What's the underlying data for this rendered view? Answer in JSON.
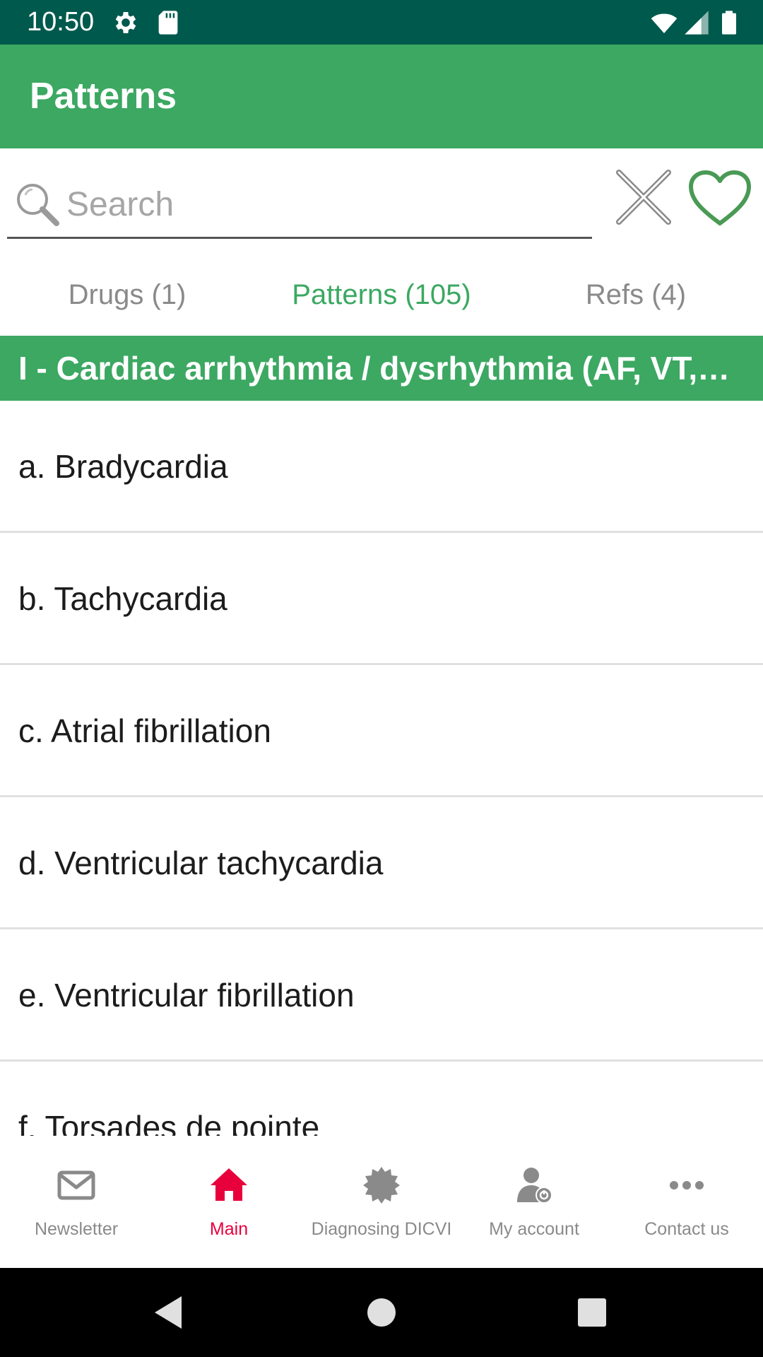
{
  "status_bar": {
    "time": "10:50",
    "left_icons": [
      "gear-icon",
      "sd-card-icon"
    ],
    "right_icons": [
      "wifi-icon",
      "cell-signal-icon",
      "battery-icon"
    ]
  },
  "app_bar": {
    "title": "Patterns",
    "color": "#3ca862"
  },
  "search": {
    "placeholder": "Search",
    "value": "",
    "clear_icon": "close-icon",
    "favorite_icon": "heart-icon"
  },
  "tabs": [
    {
      "label": "Drugs (1)",
      "active": false
    },
    {
      "label": "Patterns (105)",
      "active": true
    },
    {
      "label": "Refs (4)",
      "active": false
    }
  ],
  "section": {
    "title": "I - Cardiac arrhythmia / dysrhythmia (AF, VT, VF, TdP)"
  },
  "list": {
    "items": [
      "a. Bradycardia",
      "b. Tachycardia",
      "c. Atrial fibrillation",
      "d. Ventricular tachycardia",
      "e. Ventricular fibrillation",
      "f. Torsades de pointe"
    ]
  },
  "bottom_nav": {
    "items": [
      {
        "label": "Newsletter",
        "icon": "envelope-icon",
        "active": false
      },
      {
        "label": "Main",
        "icon": "home-icon",
        "active": true
      },
      {
        "label": "Diagnosing DICVI",
        "icon": "badge-icon",
        "active": false
      },
      {
        "label": "My account",
        "icon": "user-settings-icon",
        "active": false
      },
      {
        "label": "Contact us",
        "icon": "more-dots-icon",
        "active": false
      }
    ],
    "active_color": "#e8003d",
    "inactive_color": "#8a8a8a"
  },
  "system_nav": {
    "buttons": [
      "back-icon",
      "home-circle-icon",
      "recents-square-icon"
    ]
  }
}
